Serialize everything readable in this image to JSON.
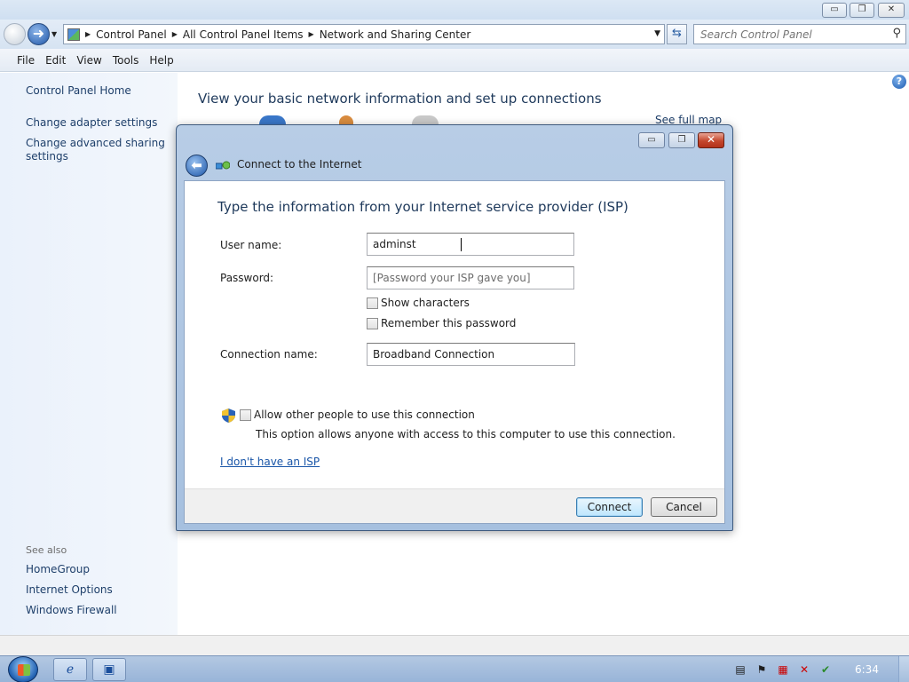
{
  "window": {
    "controls": {
      "minimize": "▭",
      "restore": "❐",
      "close": "✕"
    }
  },
  "address_bar": {
    "breadcrumbs": [
      "Control Panel",
      "All Control Panel Items",
      "Network and Sharing Center"
    ],
    "search_placeholder": "Search Control Panel"
  },
  "menu": [
    "File",
    "Edit",
    "View",
    "Tools",
    "Help"
  ],
  "sidebar": {
    "home_link": "Control Panel Home",
    "links": [
      "Change adapter settings",
      "Change advanced sharing settings"
    ],
    "see_also_label": "See also",
    "see_also_links": [
      "HomeGroup",
      "Internet Options",
      "Windows Firewall"
    ]
  },
  "main": {
    "title": "View your basic network information and set up connections",
    "see_full_map": "See full map"
  },
  "dialog": {
    "title": "Connect to the Internet",
    "heading": "Type the information from your Internet service provider (ISP)",
    "username_label": "User name:",
    "username_value": "adminst",
    "password_label": "Password:",
    "password_placeholder": "[Password your ISP gave you]",
    "show_characters": "Show characters",
    "remember_password": "Remember this password",
    "connection_name_label": "Connection name:",
    "connection_name_value": "Broadband Connection",
    "allow_others": "Allow other people to use this connection",
    "allow_others_note": "This option allows anyone with access to this computer to use this connection.",
    "no_isp_link": "I don't have an ISP",
    "connect_button": "Connect",
    "cancel_button": "Cancel"
  },
  "taskbar": {
    "clock": "6:34"
  },
  "colors": {
    "accent": "#1e395b",
    "link": "#1a56a8",
    "sidebar_bg": "#eaf1fb",
    "taskbar": "#a4bddc"
  }
}
